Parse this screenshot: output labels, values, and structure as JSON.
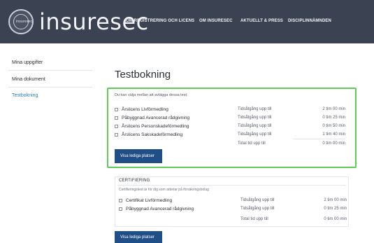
{
  "header": {
    "brand": "insuresec",
    "logo_text": "insuresec",
    "nav": [
      "OM REGISTRERING OCH LICENS",
      "OM INSURESEC",
      "AKTUELLT & PRESS",
      "DISCIPLINNÄMNDEN"
    ]
  },
  "sidebar": {
    "items": [
      {
        "label": "Mina uppgifter"
      },
      {
        "label": "Mina dokument"
      },
      {
        "label": "Testbokning",
        "active": true
      }
    ]
  },
  "main": {
    "title": "Testbokning",
    "tests": {
      "intro": "Du kan välja mellan att avlägga dessa test:",
      "time_label": "Tidsåtgång upp till",
      "rows": [
        {
          "name": "Årslicens Livförmedling",
          "time": "2 tim 00 min"
        },
        {
          "name": "Påbyggnad Avancerad rådgivning",
          "time": "0 tim 25 min"
        },
        {
          "name": "Årslicens Personskadeförmedling",
          "time": "0 tim 50 min"
        },
        {
          "name": "Årslicens Sakskadeförmedling",
          "time": "1 tim 40 min"
        }
      ],
      "total_label": "Total tid upp till",
      "total_time": "0 tim 00 min",
      "button": "Visa lediga platser"
    },
    "certifiering": {
      "title": "CERTIFIERING",
      "intro": "Certifieringstest är för dig som arbetar på försäkringsbolag",
      "time_label": "Tidsåtgång upp till",
      "rows": [
        {
          "name": "Certifikat Livförmedling",
          "time": "2 tim 00 min"
        },
        {
          "name": "Påbyggnad Avancerad rådgivning",
          "time": "0 tim 25 min"
        }
      ],
      "total_label": "Total tid upp till",
      "total_time": "0 tim 00 min",
      "button": "Visa lediga platser"
    }
  },
  "colors": {
    "header_bg": "#3b4251",
    "accent_green": "#5fcc5a",
    "button_bg": "#1f4f86",
    "active_link": "#2d7fb8"
  }
}
